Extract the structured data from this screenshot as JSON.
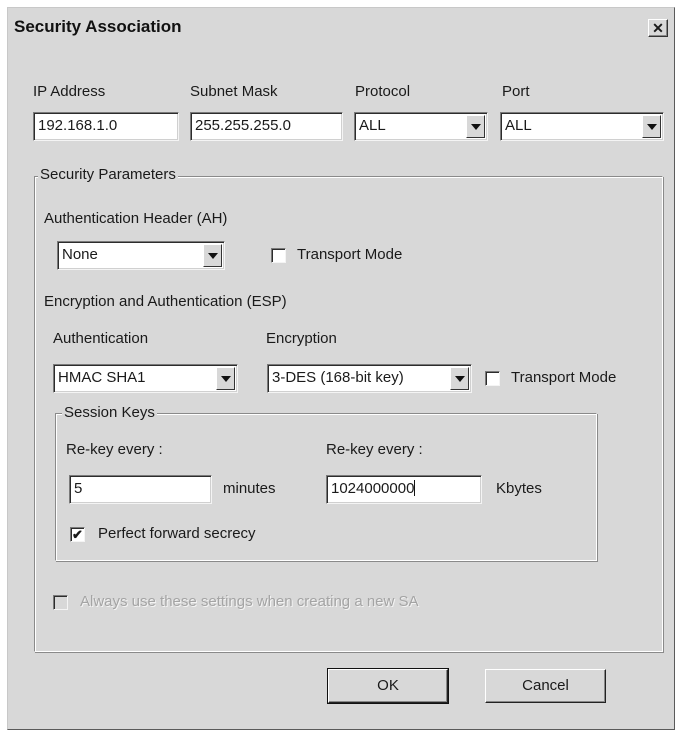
{
  "window": {
    "title": "Security Association",
    "close_glyph": "✕"
  },
  "address_row": {
    "ip_label": "IP Address",
    "ip_value": "192.168.1.0",
    "subnet_label": "Subnet Mask",
    "subnet_value": "255.255.255.0",
    "protocol_label": "Protocol",
    "protocol_value": "ALL",
    "port_label": "Port",
    "port_value": "ALL"
  },
  "security_params": {
    "legend": "Security Parameters",
    "ah": {
      "label": "Authentication Header (AH)",
      "value": "None",
      "transport_label": "Transport Mode",
      "transport_checked": false
    },
    "esp": {
      "label": "Encryption and Authentication (ESP)",
      "auth_label": "Authentication",
      "auth_value": "HMAC SHA1",
      "enc_label": "Encryption",
      "enc_value": "3-DES (168-bit key)",
      "transport_label": "Transport Mode",
      "transport_checked": false
    },
    "session_keys": {
      "legend": "Session Keys",
      "rekey_time_label": "Re-key every :",
      "rekey_time_value": "5",
      "rekey_time_unit": "minutes",
      "rekey_data_label": "Re-key every :",
      "rekey_data_value": "1024000000",
      "rekey_data_unit": "Kbytes",
      "pfs_label": "Perfect forward secrecy",
      "pfs_checked": true
    },
    "always_use_label": "Always use these settings when creating a new SA",
    "always_use_enabled": false
  },
  "buttons": {
    "ok": "OK",
    "cancel": "Cancel"
  }
}
